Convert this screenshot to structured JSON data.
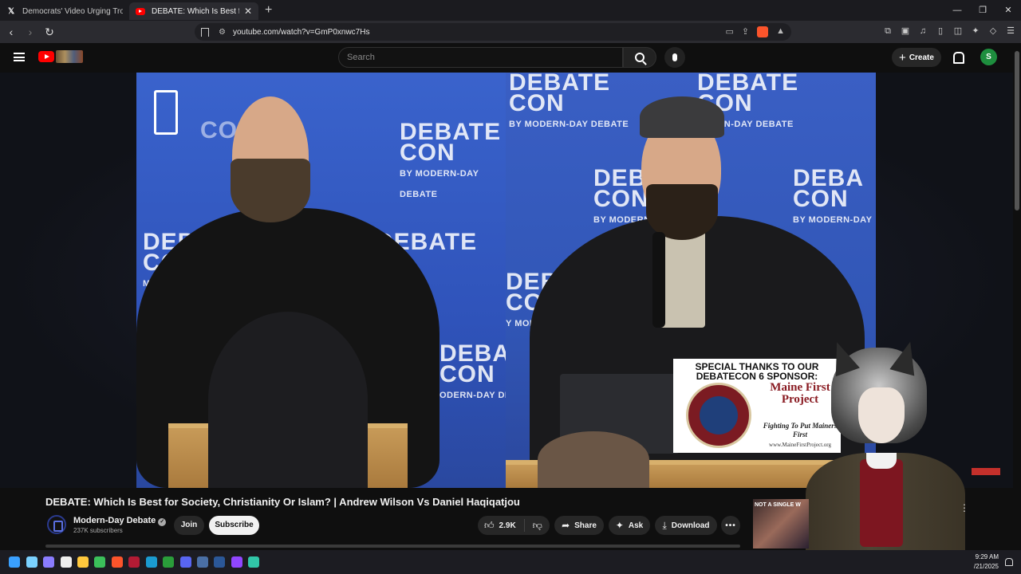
{
  "tabs": [
    {
      "label": "Democrats' Video Urging Troops to R",
      "favicon": "x-icon",
      "active": false
    },
    {
      "label": "DEBATE: Which Is Best for Society",
      "favicon": "youtube-icon",
      "active": true
    }
  ],
  "address_bar": {
    "url": "youtube.com/watch?v=GmP0xnwc7Hs"
  },
  "youtube": {
    "search_placeholder": "Search",
    "create_label": "Create",
    "avatar_letter": "S"
  },
  "video": {
    "watermark_brand": "MODERN-DAY\nDEBATE",
    "backdrop_text": "DEBATE CON",
    "backdrop_sub": "BY MODERN-DAY DEBATE",
    "sponsor": {
      "heading": "SPECIAL THANKS TO OUR DEBATECON 6 SPONSOR:",
      "name": "Maine First Project",
      "tagline": "Fighting To Put Mainers First",
      "url": "www.MaineFirstProject.org"
    }
  },
  "info": {
    "title": "DEBATE: Which Is Best for Society, Christianity Or Islam? | Andrew Wilson Vs Daniel Haqiqatjou",
    "channel_name": "Modern-Day Debate",
    "subscribers": "237K subscribers",
    "join_label": "Join",
    "subscribe_label": "Subscribe",
    "likes": "2.9K",
    "share_label": "Share",
    "ask_label": "Ask",
    "download_label": "Download",
    "more_label": "•••"
  },
  "recommendation": {
    "thumb_text": "NOT A SINGLE W"
  },
  "taskbar": {
    "time": "9:29 AM",
    "date": "/21/2025"
  },
  "colors": {
    "youtube_red": "#ff0000",
    "brave_orange": "#fb542b",
    "avatar_green": "#1e8e3e",
    "backdrop_blue": "#3156b6"
  }
}
